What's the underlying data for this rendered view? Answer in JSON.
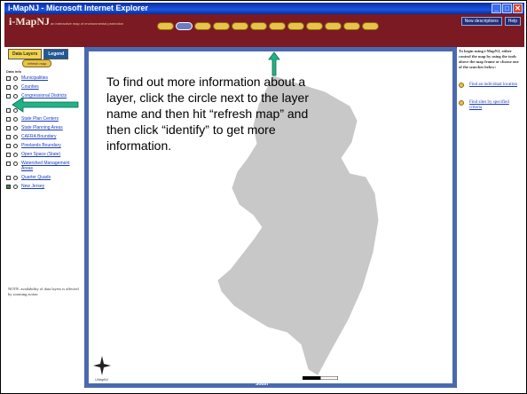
{
  "window": {
    "title": "i-MapNJ - Microsoft Internet Explorer"
  },
  "header": {
    "logo": "i-MapNJ",
    "tagline": "an interactive map of environmental protection",
    "buttons": [
      "New descriptions",
      "Help"
    ]
  },
  "left_panel": {
    "tabs": [
      "Data Layers",
      "Legend"
    ],
    "refresh_label": "refresh map",
    "data_info": "Data info",
    "layers": [
      {
        "label": "Municipalities",
        "checked": false,
        "tall": false
      },
      {
        "label": "Counties",
        "checked": false,
        "tall": false
      },
      {
        "label": "Congressional Districts",
        "checked": false,
        "tall": true
      },
      {
        "label": "",
        "checked": false,
        "tall": false
      },
      {
        "label": "State Plan Centers",
        "checked": false,
        "tall": false
      },
      {
        "label": "State Planning Areas",
        "checked": false,
        "tall": false
      },
      {
        "label": "CAFRA Boundary",
        "checked": false,
        "tall": false
      },
      {
        "label": "Pinelands Boundary",
        "checked": false,
        "tall": false
      },
      {
        "label": "Open Space (State)",
        "checked": false,
        "tall": false
      },
      {
        "label": "Watershed Management Areas",
        "checked": false,
        "tall": true
      },
      {
        "label": "Quarter Quads",
        "checked": false,
        "tall": false
      },
      {
        "label": "New Jersey",
        "checked": true,
        "tall": false
      }
    ],
    "note": "NOTE: availability of data layers is affected by zooming action"
  },
  "map": {
    "instruction": "To find out more information about a layer, click the circle next to the layer name and then hit “refresh map” and then click “identify” to get more information.",
    "pan_south": "South",
    "compass_label": "i-MapNJ"
  },
  "right_panel": {
    "intro": "To begin using i-MapNJ, either control the map by using the tools above the map frame or choose one of the searches below:",
    "links": [
      "Find an individual location",
      "Find sites by specified criteria"
    ]
  },
  "colors": {
    "header": "#7b1a22",
    "accent_arrow": "#22b28a",
    "map_land": "#c8c8c8",
    "frame_blue": "#4a6ab0"
  }
}
